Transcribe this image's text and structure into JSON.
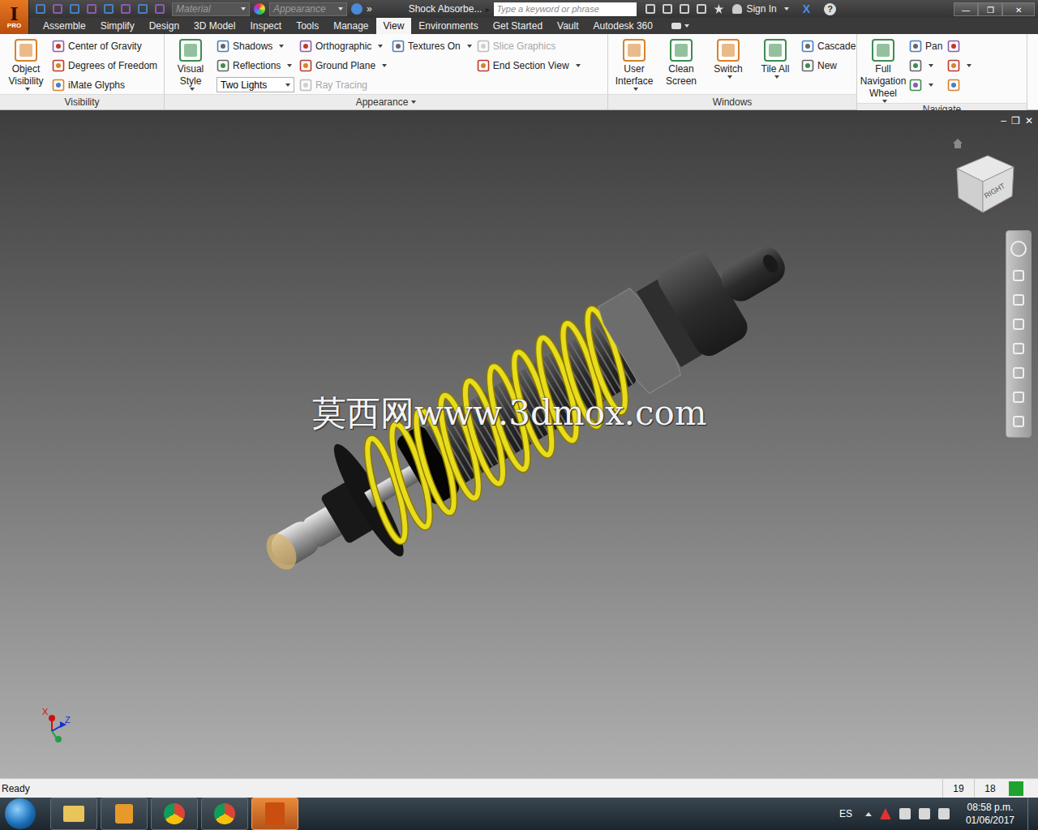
{
  "app": {
    "logo": "I",
    "edition": "PRO"
  },
  "title_bar": {
    "material": "Material",
    "appearance": "Appearance",
    "overflow": "»",
    "document_title": "Shock Absorbe...",
    "title_arrow": "▸",
    "search_placeholder": "Type a keyword or phrase",
    "sign_in": "Sign In",
    "help": "?",
    "close_x": "X",
    "window_controls": [
      "—",
      "❐",
      "✕"
    ]
  },
  "menu_tabs": [
    {
      "label": "Assemble",
      "selected": false
    },
    {
      "label": "Simplify",
      "selected": false
    },
    {
      "label": "Design",
      "selected": false
    },
    {
      "label": "3D Model",
      "selected": false
    },
    {
      "label": "Inspect",
      "selected": false
    },
    {
      "label": "Tools",
      "selected": false
    },
    {
      "label": "Manage",
      "selected": false
    },
    {
      "label": "View",
      "selected": true
    },
    {
      "label": "Environments",
      "selected": false
    },
    {
      "label": "Get Started",
      "selected": false
    },
    {
      "label": "Vault",
      "selected": false
    },
    {
      "label": "Autodesk 360",
      "selected": false
    }
  ],
  "ribbon": {
    "panels": [
      {
        "title": "Visibility",
        "menu": false,
        "columns": [
          {
            "items": [
              {
                "kind": "large",
                "label": "Object Visibility",
                "dropdown": true,
                "disabled": false
              }
            ]
          },
          {
            "items": [
              {
                "kind": "small",
                "label": "Center of Gravity",
                "dropdown": false,
                "disabled": false
              },
              {
                "kind": "small",
                "label": "Degrees of Freedom",
                "dropdown": false,
                "disabled": false
              },
              {
                "kind": "small",
                "label": "iMate Glyphs",
                "dropdown": false,
                "disabled": false
              }
            ]
          }
        ]
      },
      {
        "title": "Appearance",
        "menu": true,
        "columns": [
          {
            "items": [
              {
                "kind": "large",
                "label": "Visual Style",
                "dropdown": true,
                "disabled": false
              }
            ]
          },
          {
            "items": [
              {
                "kind": "small",
                "label": "Shadows",
                "dropdown": true,
                "disabled": false
              },
              {
                "kind": "small",
                "label": "Reflections",
                "dropdown": true,
                "disabled": false
              },
              {
                "kind": "combo",
                "label": "Two Lights",
                "dropdown": true,
                "disabled": false
              }
            ]
          },
          {
            "items": [
              {
                "kind": "small",
                "label": "Orthographic",
                "dropdown": true,
                "disabled": false
              },
              {
                "kind": "small",
                "label": "Ground Plane",
                "dropdown": true,
                "disabled": false
              },
              {
                "kind": "small",
                "label": "Ray Tracing",
                "dropdown": false,
                "disabled": true
              }
            ]
          },
          {
            "items": [
              {
                "kind": "small",
                "label": "Textures On",
                "dropdown": true,
                "disabled": false
              }
            ]
          },
          {
            "items": [
              {
                "kind": "small",
                "label": "Slice Graphics",
                "dropdown": false,
                "disabled": true
              },
              {
                "kind": "small",
                "label": "End Section View",
                "dropdown": true,
                "disabled": false
              }
            ]
          }
        ]
      },
      {
        "title": "Windows",
        "menu": false,
        "columns": [
          {
            "items": [
              {
                "kind": "large",
                "label": "User Interface",
                "dropdown": true,
                "disabled": false
              }
            ]
          },
          {
            "items": [
              {
                "kind": "large",
                "label": "Clean Screen",
                "dropdown": false,
                "disabled": false
              }
            ]
          },
          {
            "items": [
              {
                "kind": "large",
                "label": "Switch",
                "dropdown": true,
                "disabled": false
              }
            ]
          },
          {
            "items": [
              {
                "kind": "large",
                "label": "Tile All",
                "dropdown": true,
                "disabled": false
              }
            ]
          },
          {
            "items": [
              {
                "kind": "small",
                "label": "Cascade",
                "dropdown": false,
                "disabled": false
              },
              {
                "kind": "small",
                "label": "New",
                "dropdown": false,
                "disabled": false
              }
            ]
          }
        ]
      },
      {
        "title": "Navigate",
        "menu": false,
        "columns": [
          {
            "items": [
              {
                "kind": "large",
                "label": "Full Navigation Wheel",
                "dropdown": true,
                "disabled": false
              }
            ]
          },
          {
            "items": [
              {
                "kind": "small",
                "label": "Pan",
                "dropdown": false,
                "disabled": false
              },
              {
                "kind": "icon",
                "dropdown": true,
                "disabled": false
              },
              {
                "kind": "icon",
                "dropdown": true,
                "disabled": false
              }
            ]
          },
          {
            "items": [
              {
                "kind": "icon",
                "dropdown": false,
                "disabled": false
              },
              {
                "kind": "icon",
                "dropdown": true,
                "disabled": false
              },
              {
                "kind": "icon",
                "dropdown": false,
                "disabled": false
              }
            ]
          }
        ]
      }
    ]
  },
  "viewport": {
    "watermark": "莫西网www.3dmox.com",
    "view_cube_face": "RIGHT",
    "window_controls": [
      "–",
      "❐",
      "✕"
    ],
    "axes": [
      {
        "label": "X",
        "color": "#d01010"
      },
      {
        "label": "Z",
        "color": "#1030d0"
      }
    ]
  },
  "status_bar": {
    "message": "Ready",
    "counts": [
      "19",
      "18"
    ]
  },
  "taskbar": {
    "language": "ES",
    "time": "08:58 p.m.",
    "date": "01/06/2017",
    "apps": [
      {
        "kind": "folder",
        "active": false
      },
      {
        "kind": "media",
        "active": false
      },
      {
        "kind": "chrome",
        "active": false
      },
      {
        "kind": "chrome",
        "active": false
      },
      {
        "kind": "inventor",
        "active": true
      }
    ]
  }
}
